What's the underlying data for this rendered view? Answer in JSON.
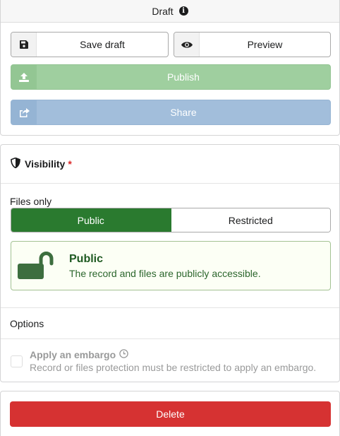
{
  "status": {
    "label": "Draft",
    "icon": "info-icon"
  },
  "actions": {
    "save_label": "Save draft",
    "save_icon": "floppy-disk-icon",
    "preview_label": "Preview",
    "preview_icon": "eye-icon",
    "publish_label": "Publish",
    "publish_icon": "upload-icon",
    "share_label": "Share",
    "share_icon": "share-square-icon"
  },
  "visibility": {
    "title": "Visibility",
    "required_mark": "*",
    "icon": "shield-icon",
    "files_only_label": "Files only",
    "options": [
      "Public",
      "Restricted"
    ],
    "selected": "Public",
    "message": {
      "title": "Public",
      "description": "The record and files are publicly accessible.",
      "icon": "unlock-icon"
    },
    "options_label": "Options",
    "embargo": {
      "label": "Apply an embargo",
      "icon": "clock-icon",
      "help": "Record or files protection must be restricted to apply an embargo.",
      "checked": false,
      "disabled": true
    }
  },
  "delete": {
    "label": "Delete"
  },
  "colors": {
    "public_green": "#2a7a2f",
    "publish_disabled": "#9fcf9f",
    "share_disabled": "#a2bedb",
    "delete_red": "#d63232",
    "required_red": "#db2828"
  }
}
